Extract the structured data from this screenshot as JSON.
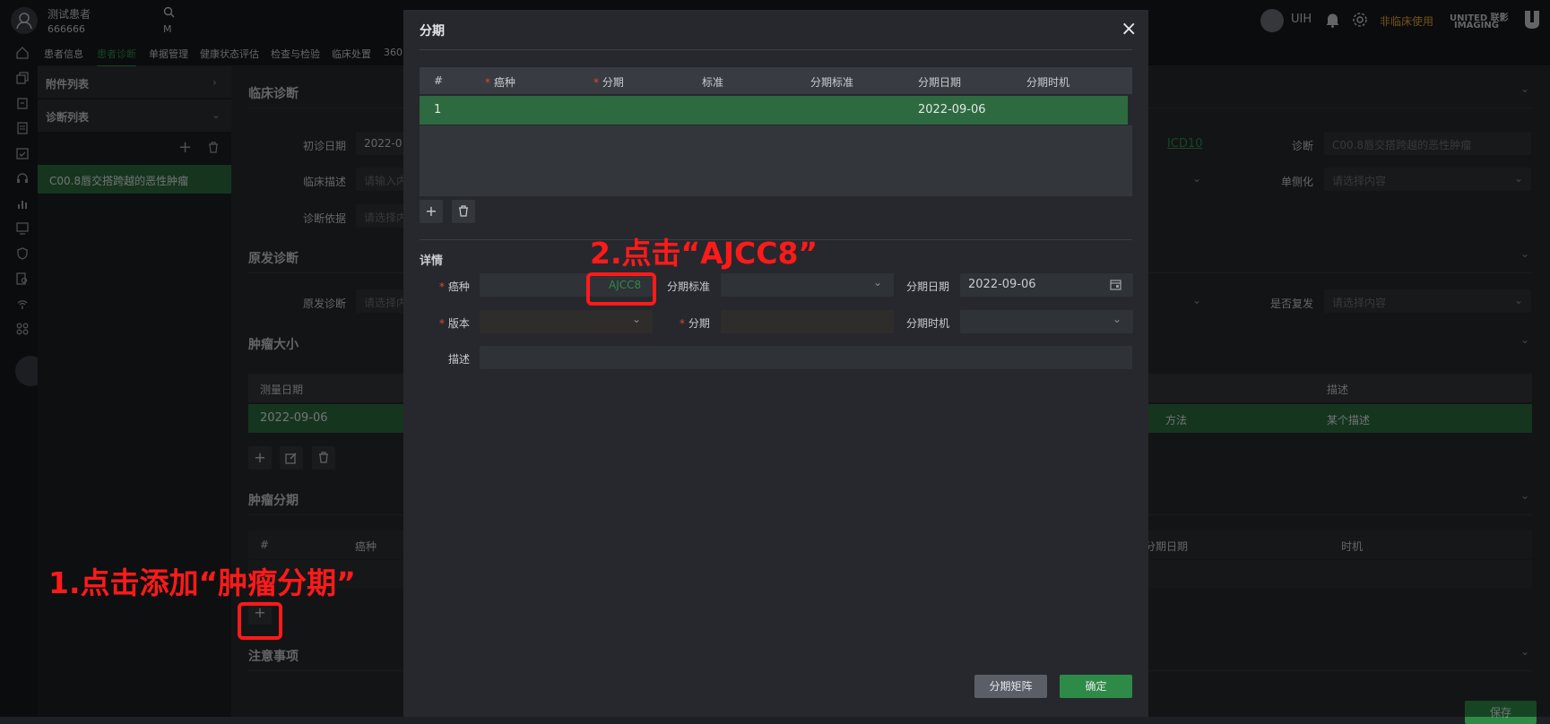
{
  "topbar": {
    "patient_name": "测试患者",
    "patient_id": "666666",
    "patient_sex": "M",
    "user_name": "UIH",
    "non_clinical": "非临床使用",
    "brand_line1": "UNITED 联影",
    "brand_line2": "IMAGING"
  },
  "tabs": [
    "患者信息",
    "患者诊断",
    "单据管理",
    "健康状态评估",
    "检查与检验",
    "临床处置",
    "360"
  ],
  "left_panel": {
    "attachments_title": "附件列表",
    "diagnosis_title": "诊断列表",
    "selected_item": "C00.8唇交搭跨越的恶性肿瘤"
  },
  "main": {
    "clinical_section": "临床诊断",
    "first_date_label": "初诊日期",
    "first_date_value": "2022-0",
    "clinical_desc_label": "临床描述",
    "clinical_desc_placeholder": "请输入内",
    "diag_basis_label": "诊断依据",
    "diag_basis_placeholder": "请选择内",
    "icd_link": "ICD10",
    "diagnosis_label": "诊断",
    "diagnosis_value": "C00.8唇交搭跨越的恶性肿瘤",
    "laterality_label": "单侧化",
    "laterality_placeholder": "请选择内容",
    "primary_section": "原发诊断",
    "primary_label": "原发诊断",
    "primary_placeholder": "请选择内",
    "recurrence_label": "是否复发",
    "recurrence_placeholder": "请选择内容",
    "tumor_size_section": "肿瘤大小",
    "size_col_date": "测量日期",
    "size_col_desc": "描述",
    "size_row_date": "2022-09-06",
    "size_row_method": "方法",
    "size_row_desc": "某个描述",
    "staging_section": "肿瘤分期",
    "staging_col_no": "#",
    "staging_col_type": "癌种",
    "staging_col_date": "分期日期",
    "staging_col_timing": "时机",
    "notes_section": "注意事项",
    "save_button": "保存"
  },
  "dialog": {
    "title": "分期",
    "close": "×",
    "table_headers": [
      "#",
      "癌种",
      "分期",
      "标准",
      "分期标准",
      "分期日期",
      "分期时机"
    ],
    "row": {
      "no": "1",
      "date": "2022-09-06"
    },
    "details_title": "详情",
    "cancer_type_label": "癌种",
    "ajcc_link": "AJCC8",
    "stage_standard_label": "分期标准",
    "stage_date_label": "分期日期",
    "stage_date_value": "2022-09-06",
    "version_label": "版本",
    "stage_label": "分期",
    "stage_timing_label": "分期时机",
    "desc_label": "描述",
    "matrix_button": "分期矩阵",
    "confirm_button": "确定"
  },
  "annotations": {
    "step1": "1.点击添加“肿瘤分期”",
    "step2": "2.点击“AJCC8”"
  },
  "colors": {
    "accent_green": "#2e8b47",
    "row_green": "#2d6a3f",
    "annotation_red": "#ff1a1a",
    "warning_orange": "#e6a23c"
  }
}
